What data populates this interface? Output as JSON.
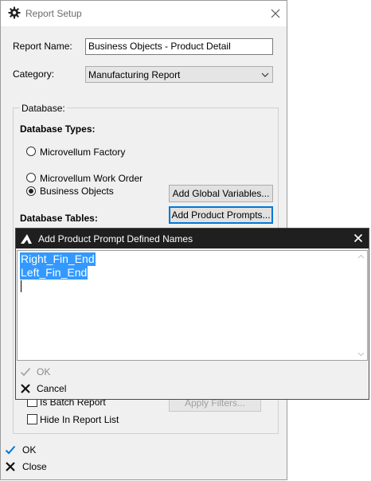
{
  "window": {
    "title": "Report Setup"
  },
  "form": {
    "report_name_label": "Report Name:",
    "report_name_value": "Business Objects - Product Detail",
    "category_label": "Category:",
    "category_value": "Manufacturing Report"
  },
  "database": {
    "group_label": "Database:",
    "types_label": "Database Types:",
    "options": [
      {
        "label": "Microvellum Factory",
        "selected": false
      },
      {
        "label": "Microvellum Work Order",
        "selected": false
      },
      {
        "label": "Business Objects",
        "selected": true
      }
    ],
    "add_global_variables_button": "Add Global Variables...",
    "add_product_prompts_button": "Add Product Prompts...",
    "tables_label": "Database Tables:",
    "is_batch_report_label": "Is Batch Report",
    "apply_filters_button": "Apply Filters...",
    "hide_in_report_list_label": "Hide In Report List"
  },
  "footer": {
    "ok_label": "OK",
    "close_label": "Close"
  },
  "dialog": {
    "title": "Add Product Prompt Defined Names",
    "lines": [
      "Right_Fin_End",
      "Left_Fin_End"
    ],
    "ok_label": "OK",
    "cancel_label": "Cancel"
  },
  "colors": {
    "selection": "#3399ff",
    "check_blue": "#0078d7",
    "dialog_titlebar": "#1f1f1f"
  }
}
